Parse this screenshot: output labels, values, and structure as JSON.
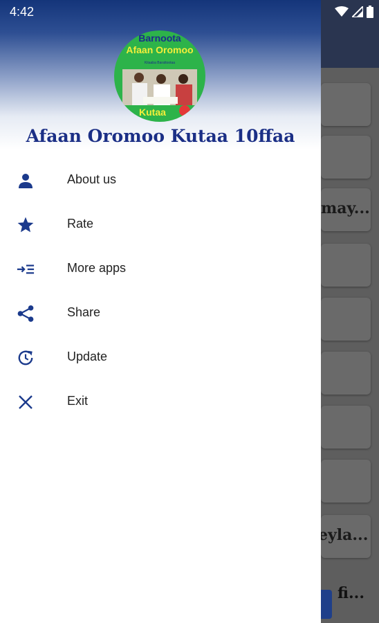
{
  "status_bar": {
    "time": "4:42",
    "icons": [
      "wifi-icon",
      "signal-icon",
      "battery-icon"
    ]
  },
  "drawer": {
    "logo": {
      "line1": "Barnoota",
      "line2": "Afaan Oromoo",
      "sub": "Kitaaba Barattootaa",
      "badge_text": "Kutaa"
    },
    "title": "Afaan Oromoo Kutaa 10ffaa",
    "menu_items": [
      {
        "label": "About us",
        "icon": "person-icon"
      },
      {
        "label": "Rate",
        "icon": "star-icon"
      },
      {
        "label": "More apps",
        "icon": "more-apps-icon"
      },
      {
        "label": "Share",
        "icon": "share-icon"
      },
      {
        "label": "Update",
        "icon": "update-icon"
      },
      {
        "label": "Exit",
        "icon": "close-icon"
      }
    ]
  },
  "background": {
    "visible_texts": [
      "may...",
      "eyla...",
      "fi..."
    ]
  },
  "colors": {
    "accent": "#1b2f86",
    "icon": "#1b3a8c",
    "header_top": "#14357a",
    "logo_green": "#2db34a"
  }
}
